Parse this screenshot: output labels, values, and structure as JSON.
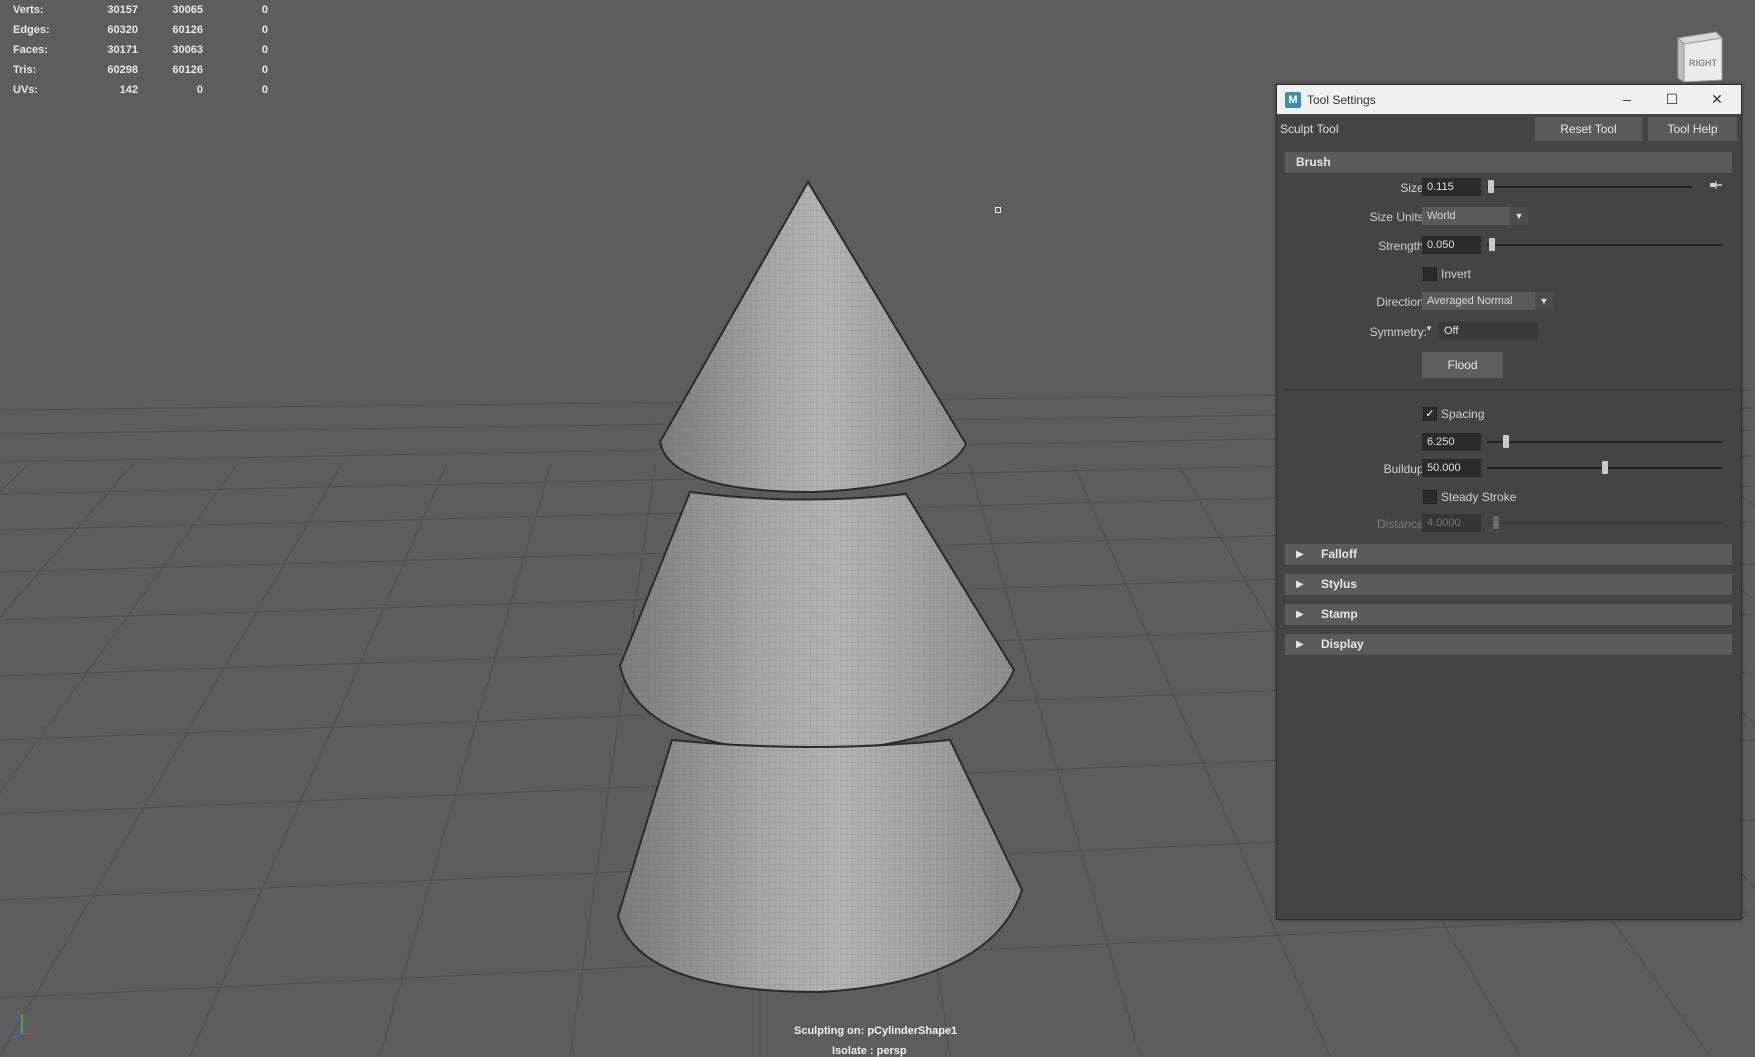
{
  "hud": {
    "rows": [
      {
        "label": "Verts:",
        "v1": "30157",
        "v2": "30065",
        "v3": "0"
      },
      {
        "label": "Edges:",
        "v1": "60320",
        "v2": "60126",
        "v3": "0"
      },
      {
        "label": "Faces:",
        "v1": "30171",
        "v2": "30063",
        "v3": "0"
      },
      {
        "label": "Tris:",
        "v1": "60298",
        "v2": "60126",
        "v3": "0"
      },
      {
        "label": "UVs:",
        "v1": "142",
        "v2": "0",
        "v3": "0"
      }
    ]
  },
  "viewport": {
    "sculpting_on": "Sculpting on: pCylinderShape1",
    "isolate": "Isolate : persp",
    "viewcube_label": "RIGHT",
    "background": "#5d5d5d"
  },
  "window": {
    "app_icon": "maya-icon",
    "title": "Tool Settings",
    "minimize": "–",
    "maximize": "☐",
    "close": "✕"
  },
  "tool": {
    "name": "Sculpt Tool",
    "reset_label": "Reset Tool",
    "help_label": "Tool Help"
  },
  "brush": {
    "header": "Brush",
    "size_label": "Size:",
    "size_value": "0.115",
    "size_slider": 0.02,
    "size_units_label": "Size Units:",
    "size_units_value": "World",
    "strength_label": "Strength:",
    "strength_value": "0.050",
    "strength_slider": 0.02,
    "invert_label": "Invert",
    "invert_checked": false,
    "direction_label": "Direction:",
    "direction_value": "Averaged Normal",
    "symmetry_label": "Symmetry:",
    "symmetry_value": "Off",
    "flood_label": "Flood",
    "spacing_label": "Spacing",
    "spacing_checked": true,
    "spacing_value": "6.250",
    "spacing_slider": 0.08,
    "buildup_label": "Buildup:",
    "buildup_value": "50.000",
    "buildup_slider": 0.5,
    "steady_label": "Steady Stroke",
    "steady_checked": false,
    "distance_label": "Distance:",
    "distance_value": "4.0000",
    "distance_slider": 0.04
  },
  "sections": [
    {
      "label": "Falloff"
    },
    {
      "label": "Stylus"
    },
    {
      "label": "Stamp"
    },
    {
      "label": "Display"
    }
  ]
}
